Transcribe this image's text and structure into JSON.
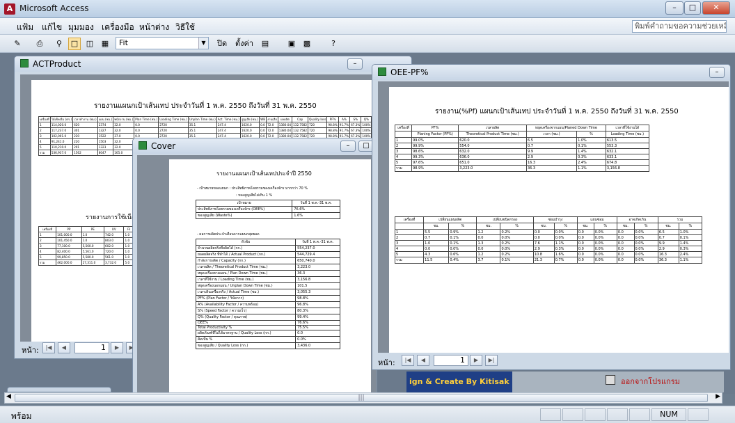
{
  "app": {
    "title": "Microsoft Access",
    "logo": "A"
  },
  "menu": [
    "แฟ้ม",
    "แก้ไข",
    "มุมมอง",
    "เครื่องมือ",
    "หน้าต่าง",
    "วิธีใช้"
  ],
  "help_placeholder": "พิมพ์คำถามขอความช่วยเหลือ",
  "toolbar": {
    "zoom": "Fit",
    "close_label": "ปิด",
    "setup_label": "ตั้งค่า"
  },
  "act": {
    "title": "ACTProduct",
    "report_title": "รายงานแผนกเป้าเส้นเทป ประจำวันที่  1 พ.ค. 2550   ถึงวันที่  31 พ.ค. 2550",
    "headers": [
      "เครื่องที่",
      "ไม้เช็คเริ่ม (ตร.)",
      "เวลาทำงาน (ชม.)",
      "แผน (ชม.)",
      "พนักงาน (ชม.)",
      "Plan Time (ชม.)",
      "Loading Time (ชม.)",
      "Unplan Time (ชม.)",
      "Act. Time (ชม.)",
      "สูญเสีย (ชม.)",
      "WB",
      "งานเสีย",
      "ผลผลิต",
      "Cap",
      "Quality loss",
      "PF%",
      "A%",
      "S%",
      "Q%",
      "OEE%",
      "Total Pro.%"
    ],
    "rows": [
      [
        "1",
        "114,020.0",
        "620",
        "2374",
        "32.0",
        "0.0",
        "2720",
        "35.1",
        "247.4",
        "1620.0",
        "0.0",
        "72.0",
        "1380.04",
        "132.7582",
        "720",
        "98.8%",
        "91.7%",
        "67.3%",
        "100%",
        "77.7%",
        "75.9%"
      ],
      [
        "2",
        "117,237.0",
        "301",
        "1327",
        "32.0",
        "0.0",
        "2720",
        "35.1",
        "247.4",
        "1620.0",
        "0.0",
        "72.0",
        "1380.04",
        "132.7582",
        "720",
        "98.8%",
        "91.7%",
        "67.3%",
        "100%",
        "77.7%",
        "75.9%"
      ],
      [
        "3",
        "102,001.0",
        "220",
        "1522",
        "37.0",
        "0.0",
        "2720",
        "35.1",
        "247.4",
        "1620.0",
        "0.0",
        "72.0",
        "1380.04",
        "132.7582",
        "720",
        "98.8%",
        "91.7%",
        "67.3%",
        "100%",
        "77.7%",
        "75.9%"
      ],
      [
        "4",
        "91,241.0",
        "220",
        "1503",
        "32.0",
        "0.0",
        "2720",
        "35.1",
        "247.4",
        "1620.0",
        "0.0",
        "72.0",
        "1380.04",
        "132.7582",
        "720",
        "98.8%",
        "91.7%",
        "67.3%",
        "100%",
        "77.7%",
        "75.9%"
      ],
      [
        "5",
        "110,210.0",
        "201",
        "1323",
        "32.0",
        "0.0",
        "2720",
        "35.1",
        "247.4",
        "1620.0",
        "0.0",
        "72.0",
        "1380.04",
        "132.7582",
        "720",
        "98.8%",
        "91.7%",
        "67.3%",
        "100%",
        "77.7%",
        "75.9%"
      ],
      [
        "รวม",
        "536,937.0",
        "1562",
        "8047",
        "165.0",
        "0.0",
        "2720",
        "35.1",
        "247.4",
        "1620.0",
        "0.0",
        "72.0",
        "1380.04",
        "132.7582",
        "720",
        "98.8%",
        "91.7%",
        "67.3%",
        "100%",
        "77.7%",
        "75.9%"
      ]
    ],
    "sub_title": "รายงานการใช้เน็ต",
    "sub_headers": [
      "เครื่องที่",
      "PP",
      "PE",
      "UV",
      "Fil"
    ],
    "sub_rows": [
      [
        "1",
        "101,000.0",
        "1.0",
        "742.0",
        "1.0"
      ],
      [
        "2",
        "101,450.0",
        "1.0",
        "803.0",
        "1.0"
      ],
      [
        "3",
        "77,100.0",
        "5,560.0",
        "602.0",
        "1.0"
      ],
      [
        "4",
        "82,400.0",
        "5,561.0",
        "720.0",
        "1.0"
      ],
      [
        "5",
        "99,850.0",
        "5,580.0",
        "561.0",
        "1.0"
      ],
      [
        "รวม",
        "462,000.0",
        "27,311.0",
        "3,732.0",
        "5.0"
      ]
    ],
    "nav_label": "หน้า:",
    "page": "1"
  },
  "cover": {
    "title": "Cover",
    "report_title": "รายงานแผนกเป้าเส้นเทปประจำปี  2550",
    "note1": "- เป้าหมายของแผนก : ประสิทธิภาพโดยรวมของเครื่องจักร มากกว่า 70 %",
    "note2": ": ของสูญเสียไม่เกิน 1 %",
    "t1_headers": [
      "เป้าหมาย",
      "วันที่ 1 พ.ค.-31 พ.ค."
    ],
    "t1_rows": [
      [
        "ประสิทธิภาพโดยรวมของเครื่องจักร (OEE%)",
        "76.6%"
      ],
      [
        "ของสูญเสีย (Waste%)",
        "1.6%"
      ]
    ],
    "note3": "- ผลการผลิตประจำเดือนจากแผนกสุดยอด",
    "t2_headers": [
      "หัวข้อ",
      "วันที่ 1 พ.ค.-31 พ.ค."
    ],
    "t2_rows": [
      [
        "จำนวนผลิตจริงที่ผลิตได้ (กก.)",
        "554,237.0"
      ],
      [
        "ยอดผลิตจริง ที่ทำได้ / Actual Product (กก.)",
        "544,729.4"
      ],
      [
        "กำลังการผลิต / Capacity (กก.)",
        "650,740.0"
      ],
      [
        "เวลาผลิต / Theoretical Product Time (ชม.)",
        "3,223.0"
      ],
      [
        "หยุดเครื่องตามแผน / Plan Down Time (ชม.)",
        "36.3"
      ],
      [
        "เวลาที่ใช้งาน / Loading Time (ชม.)",
        "3,156.8"
      ],
      [
        "หยุดเครื่องนอกแผน / Unplan Down Time (ชม.)",
        "101.5"
      ],
      [
        "เวลาเดินเครื่องจริง / Actual Time (ชม.)",
        "3,055.3"
      ],
      [
        "PF% (Plan Factor / วินัยการ)",
        "98.8%"
      ],
      [
        "A% (Availability Factor / ความพร้อม)",
        "96.8%"
      ],
      [
        "S% (Speed Factor / ความเร็ว)",
        "80.3%"
      ],
      [
        "Q% (Quality Factor / คุณภาพ)",
        "99.4%"
      ],
      [
        "OEE%",
        "76.6%"
      ],
      [
        "Total Productivity %",
        "75.5%"
      ],
      [
        "ผลิตภัณฑ์ที่ไม่ได้มาตรฐาน / Quality Loss (กก.)",
        "0.0"
      ],
      [
        "คิดเป็น %",
        "0.0%"
      ],
      [
        "ของสูญเสีย / Quality Loss (กก.)",
        "3,436.0"
      ]
    ]
  },
  "oee": {
    "title": "OEE-PF%",
    "report_title": "รายงาน(%Pf) แผนกเป้าเส้นเทป ประจำวันที่  1 พ.ค. 2550   ถึงวันที่  31 พ.ค. 2550",
    "t1_groups": [
      "เครื่องที่",
      "PF%",
      "เวลาผลิต",
      "หยุดเครื่องจากแผน/Planed Down Time",
      "เวลาที่ใช้งานได้"
    ],
    "t1_sub": [
      "Planing Factor (PF%)",
      "Theoretical Product Time (ชม.)",
      "เวลา (ชม.)",
      "%",
      "Loading Time (ชม.)"
    ],
    "t1_rows": [
      [
        "1",
        "99.0%",
        "620.0",
        "6.5",
        "1.0%",
        "613.5"
      ],
      [
        "2",
        "99.9%",
        "554.0",
        "0.7",
        "0.1%",
        "553.3"
      ],
      [
        "3",
        "98.6%",
        "632.0",
        "9.9",
        "1.4%",
        "632.1"
      ],
      [
        "4",
        "99.3%",
        "636.0",
        "2.9",
        "0.3%",
        "633.1"
      ],
      [
        "5",
        "97.6%",
        "651.0",
        "16.3",
        "2.4%",
        "674.8"
      ],
      [
        "รวม",
        "98.9%",
        "3,223.0",
        "36.3",
        "1.1%",
        "3,156.8"
      ]
    ],
    "t2_groups": [
      "เครื่องที่",
      "เปลี่ยนแผนผลิต",
      "เปลี่ยนชนิดกรอง",
      "ซ่อมบำรุง",
      "แผนซ่อม",
      "อาจเกิดเกิน",
      "รวม"
    ],
    "t2_sub": [
      "ชม.",
      "%",
      "ชม.",
      "%",
      "ชม.",
      "%",
      "ชม.",
      "%",
      "ชม.",
      "%",
      "ชม.",
      "%"
    ],
    "t2_rows": [
      [
        "1",
        "5.5",
        "0.9%",
        "1.2",
        "0.2%",
        "0.0",
        "0.0%",
        "0.0",
        "0.0%",
        "0.0",
        "0.0%",
        "6.5",
        "1.0%"
      ],
      [
        "2",
        "0.7",
        "0.1%",
        "0.0",
        "0.0%",
        "0.0",
        "0.0%",
        "0.0",
        "0.0%",
        "0.0",
        "0.0%",
        "0.7",
        "0.1%"
      ],
      [
        "3",
        "1.0",
        "0.1%",
        "1.3",
        "0.2%",
        "7.6",
        "1.1%",
        "0.0",
        "0.0%",
        "0.0",
        "0.0%",
        "9.9",
        "1.4%"
      ],
      [
        "4",
        "0.0",
        "0.0%",
        "0.0",
        "0.0%",
        "2.9",
        "0.3%",
        "0.0",
        "0.0%",
        "0.0",
        "0.0%",
        "2.9",
        "0.3%"
      ],
      [
        "5",
        "4.3",
        "0.6%",
        "1.2",
        "0.2%",
        "10.8",
        "1.6%",
        "0.0",
        "0.0%",
        "0.0",
        "0.0%",
        "16.3",
        "2.4%"
      ],
      [
        "รวม",
        "11.5",
        "0.4%",
        "3.7",
        "0.1%",
        "21.3",
        "0.7%",
        "0.0",
        "0.0%",
        "0.0",
        "0.0%",
        "36.3",
        "1.1%"
      ]
    ],
    "nav_label": "หน้า:",
    "page": "1"
  },
  "banner": {
    "text": "ign & Create By Kitisak",
    "exit_label": "ออกจากโปรแกรม"
  },
  "status": {
    "text": "พร้อม",
    "num": "NUM"
  }
}
